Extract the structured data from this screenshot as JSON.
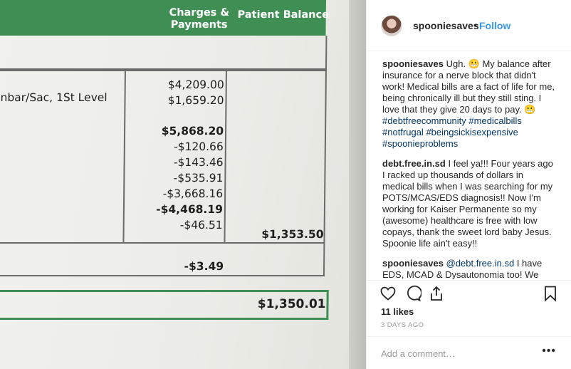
{
  "bill": {
    "col_charges": "Charges &\nPayments",
    "col_balance": "Patient Balance",
    "service": "nbar/Sac, 1St Level",
    "amounts": [
      "$4,209.00",
      "$1,659.20",
      "$5,868.20",
      "-$120.66",
      "-$143.46",
      "-$535.91",
      "-$3,668.16",
      "-$4,468.19",
      "-$46.51"
    ],
    "balance": "$1,353.50",
    "adjustment": "-$3.49",
    "total": "$1,350.01"
  },
  "header": {
    "username": "spooniesaves",
    "separator": "•",
    "follow_label": "Follow"
  },
  "caption": {
    "user": "spooniesaves",
    "text": " Ugh. 😬 My balance after insurance for a nerve block that didn't work! Medical bills are a fact of life for me, being chronically ill but they still sting. I love that they give 20 days to pay. 😬 ",
    "hashtags": [
      "#debtfreecommunity",
      "#medicalbills",
      "#notfrugal",
      "#beingsickisexpensive",
      "#spoonieproblems"
    ]
  },
  "comments": [
    {
      "user": "debt.free.in.sd",
      "text": " I feel ya!!! Four years ago I racked up thousands of dollars in medical bills when I was searching for my POTS/MCAS/EDS diagnosis!! Now I'm working for Kaiser Permanente so my (awesome) healthcare is free with low copays, thank the sweet lord baby Jesus. Spoonie life ain't easy!!"
    },
    {
      "user": "spooniesaves",
      "mention": "@debt.free.in.sd",
      "text": " I have EDS, MCAD & Dysautonomia too! We used to have excellent ins but my hub's company switched two years ago. It makes me so"
    }
  ],
  "likes": "11 likes",
  "time_ago": "3 DAYS AGO",
  "add_comment": {
    "placeholder": "Add a comment…"
  },
  "more_label": "•••",
  "icons": [
    "heart-icon",
    "comment-icon",
    "share-icon",
    "bookmark-icon"
  ]
}
